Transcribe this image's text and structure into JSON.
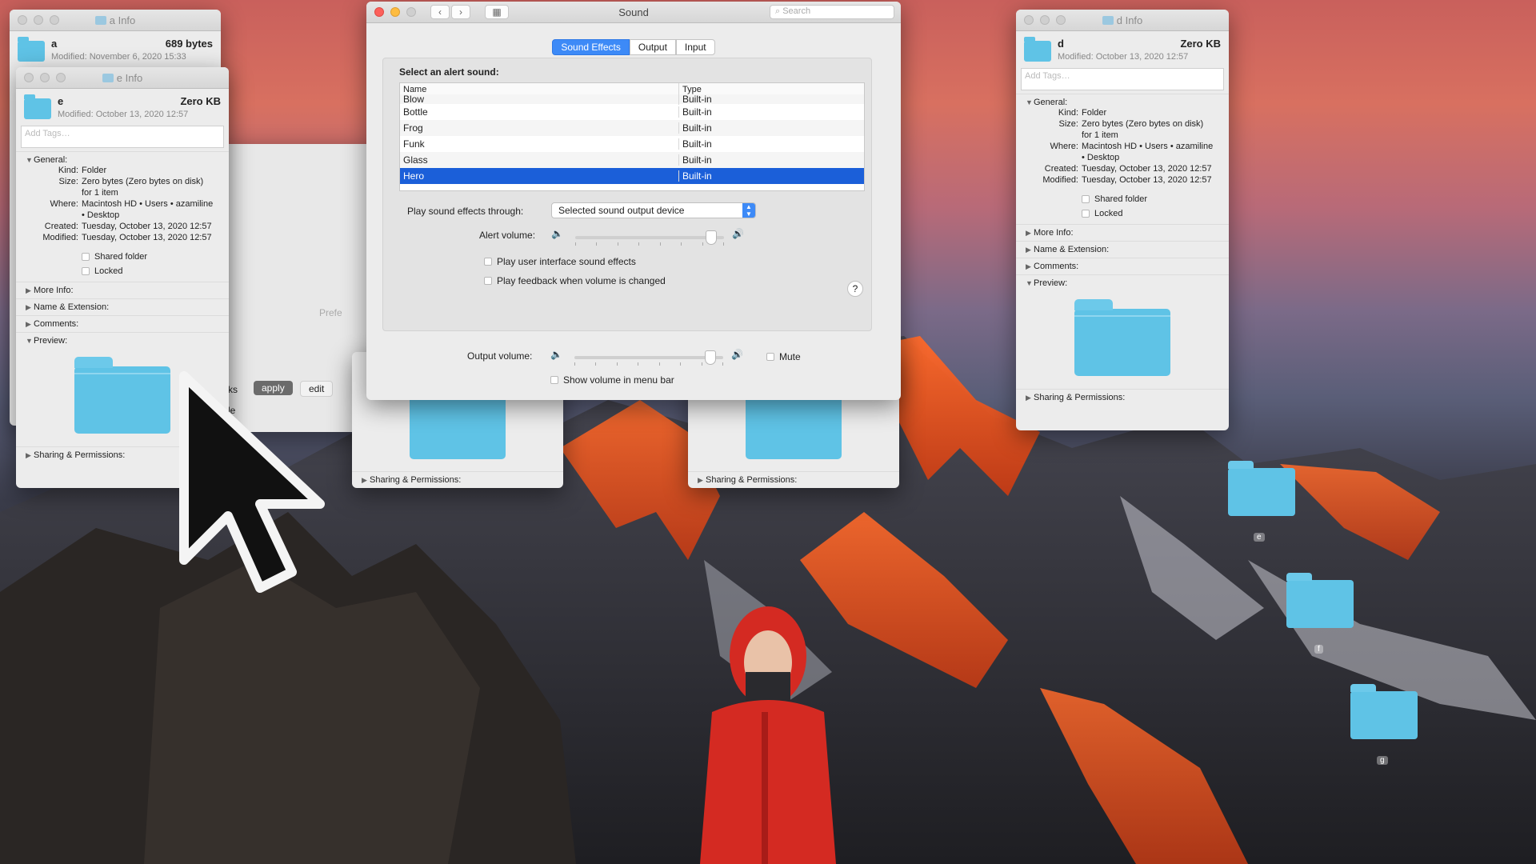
{
  "colors": {
    "accent": "#3d8af7",
    "selection": "#1b5fd9",
    "folder": "#5fc3e6"
  },
  "windows": {
    "a_info": {
      "title": "a Info",
      "name": "a",
      "size": "689 bytes",
      "modified": "Modified: November 6, 2020 15:33"
    },
    "e_info": {
      "title": "e Info",
      "name": "e",
      "size": "Zero KB",
      "modified": "Modified: October 13, 2020 12:57",
      "tags_placeholder": "Add Tags…",
      "general": {
        "header": "General:",
        "kind_label": "Kind:",
        "kind": "Folder",
        "size_label": "Size:",
        "size": "Zero bytes (Zero bytes on disk)",
        "size2": "for 1 item",
        "where_label": "Where:",
        "where": "Macintosh HD • Users • azamiline",
        "where2": "• Desktop",
        "created_label": "Created:",
        "created": "Tuesday, October 13, 2020 12:57",
        "modified_label": "Modified:",
        "modified": "Tuesday, October 13, 2020 12:57",
        "shared": "Shared folder",
        "locked": "Locked"
      },
      "sections": [
        "More Info:",
        "Name & Extension:",
        "Comments:"
      ],
      "preview": "Preview:",
      "sharing": "Sharing & Permissions:"
    },
    "d_info": {
      "title": "d Info",
      "name": "d",
      "size": "Zero KB",
      "modified": "Modified: October 13, 2020 12:57",
      "tags_placeholder": "Add Tags…",
      "general": {
        "header": "General:",
        "kind_label": "Kind:",
        "kind": "Folder",
        "size_label": "Size:",
        "size": "Zero bytes (Zero bytes on disk)",
        "size2": "for 1 item",
        "where_label": "Where:",
        "where": "Macintosh HD • Users • azamiline",
        "where2": "• Desktop",
        "created_label": "Created:",
        "created": "Tuesday, October 13, 2020 12:57",
        "modified_label": "Modified:",
        "modified": "Tuesday, October 13, 2020 12:57",
        "shared": "Shared folder",
        "locked": "Locked"
      },
      "sections": [
        "More Info:",
        "Name & Extension:",
        "Comments:"
      ],
      "preview": "Preview:",
      "sharing": "Sharing & Permissions:"
    },
    "mid_left": {
      "sharing": "Sharing & Permissions:"
    },
    "mid_right": {
      "sharing": "Sharing & Permissions:"
    },
    "behind": {
      "apply": "apply",
      "edit": "edit",
      "prefs_fragment": "Prefe",
      "ks": "ks",
      "le": "le"
    }
  },
  "sound": {
    "title": "Sound",
    "search_placeholder": "Search",
    "tabs": [
      {
        "label": "Sound Effects",
        "active": true
      },
      {
        "label": "Output",
        "active": false
      },
      {
        "label": "Input",
        "active": false
      }
    ],
    "select_label": "Select an alert sound:",
    "columns": {
      "name": "Name",
      "type": "Type"
    },
    "rows": [
      {
        "name": "Blow",
        "type": "Built-in"
      },
      {
        "name": "Bottle",
        "type": "Built-in"
      },
      {
        "name": "Frog",
        "type": "Built-in"
      },
      {
        "name": "Funk",
        "type": "Built-in"
      },
      {
        "name": "Glass",
        "type": "Built-in"
      },
      {
        "name": "Hero",
        "type": "Built-in",
        "selected": true
      }
    ],
    "play_through_label": "Play sound effects through:",
    "play_through_value": "Selected sound output device",
    "alert_volume_label": "Alert volume:",
    "alert_volume_level": 0.95,
    "ui_effects": "Play user interface sound effects",
    "feedback": "Play feedback when volume is changed",
    "help": "?",
    "output_volume_label": "Output volume:",
    "output_volume_level": 0.95,
    "mute": "Mute",
    "show_in_menubar": "Show volume in menu bar"
  },
  "desktop": {
    "folder_labels": [
      "e",
      "f",
      "g"
    ]
  }
}
